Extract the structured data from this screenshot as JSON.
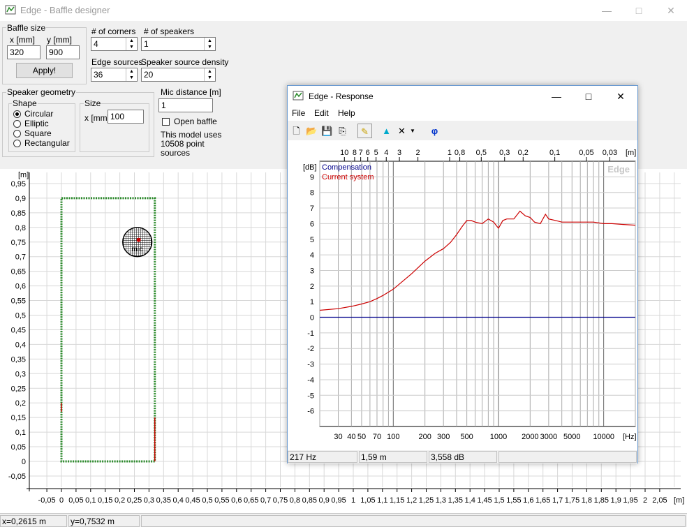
{
  "window": {
    "title": "Edge - Baffle designer"
  },
  "baffle": {
    "group_label": "Baffle size",
    "x_label": "x [mm]",
    "y_label": "y [mm]",
    "x_value": "320",
    "y_value": "900",
    "apply_label": "Apply!"
  },
  "corners": {
    "label": "# of corners",
    "value": "4"
  },
  "speakers": {
    "label": "# of speakers",
    "value": "1"
  },
  "edge_sources": {
    "label": "Edge sources",
    "value": "36"
  },
  "density": {
    "label": "Speaker source density",
    "value": "20"
  },
  "geometry": {
    "group_label": "Speaker geometry",
    "shape_label": "Shape",
    "shapes": [
      "Circular",
      "Elliptic",
      "Square",
      "Rectangular"
    ],
    "selected_shape": "Circular",
    "size_label": "Size",
    "size_x_label": "x [mm]",
    "size_x_value": "100"
  },
  "mic": {
    "label": "Mic distance [m]",
    "value": "1",
    "open_baffle_label": "Open baffle",
    "mic_marker": "mic"
  },
  "model_info": [
    "This model uses",
    "10508 point",
    "sources"
  ],
  "baffle_plot": {
    "unit_y": "[m]",
    "unit_x": "[m]",
    "y_ticks": [
      "0,95",
      "0,9",
      "0,85",
      "0,8",
      "0,75",
      "0,7",
      "0,65",
      "0,6",
      "0,55",
      "0,5",
      "0,45",
      "0,4",
      "0,35",
      "0,3",
      "0,25",
      "0,2",
      "0,15",
      "0,1",
      "0,05",
      "0",
      "-0,05"
    ],
    "x_ticks": [
      "-0,05",
      "0",
      "0,05",
      "0,1",
      "0,15",
      "0,2",
      "0,25",
      "0,3",
      "0,35",
      "0,4",
      "0,45",
      "0,5",
      "0,55",
      "0,6",
      "0,65",
      "0,7",
      "0,75",
      "0,8",
      "0,85",
      "0,9",
      "0,95",
      "1",
      "1,05",
      "1,1",
      "1,15",
      "1,2",
      "1,25",
      "1,3",
      "1,35",
      "1,4",
      "1,45",
      "1,5",
      "1,55",
      "1,6",
      "1,65",
      "1,7",
      "1,75",
      "1,8",
      "1,85",
      "1,9",
      "1,95",
      "2",
      "2,05"
    ],
    "baffle_width_m": 0.32,
    "baffle_height_m": 0.9,
    "speaker_center_m": [
      0.26,
      0.75
    ],
    "speaker_diameter_m": 0.1
  },
  "status": {
    "x": "x=0,2615 m",
    "y": "y=0,7532 m"
  },
  "response": {
    "title": "Edge - Response",
    "menus": [
      "File",
      "Edit",
      "Help"
    ],
    "watermark": "Edge",
    "legend": [
      {
        "name": "Compensation",
        "color": "#00008b"
      },
      {
        "name": "Current system",
        "color": "#cc0000"
      }
    ],
    "y_unit": "[dB]",
    "x_unit": "[Hz]",
    "top_unit": "[m]",
    "y_ticks": [
      "9",
      "8",
      "7",
      "6",
      "5",
      "4",
      "3",
      "2",
      "1",
      "0",
      "-1",
      "-2",
      "-3",
      "-4",
      "-5",
      "-6"
    ],
    "x_ticks": [
      "30",
      "40",
      "50",
      "70",
      "100",
      "200",
      "300",
      "500",
      "1000",
      "2000",
      "3000",
      "5000",
      "10000"
    ],
    "top_ticks": [
      "10",
      "8",
      "7",
      "6",
      "5",
      "4",
      "3",
      "2",
      "1",
      "0,8",
      "0,5",
      "0,3",
      "0,2",
      "0,1",
      "0,05",
      "0,03"
    ],
    "status_freq": "217 Hz",
    "status_wavelength": "1,59 m",
    "status_db": "3,558 dB"
  },
  "chart_data": {
    "type": "line",
    "xlabel": "[Hz]",
    "ylabel": "[dB]",
    "xscale": "log",
    "xlim": [
      20,
      20000
    ],
    "ylim": [
      -7,
      10
    ],
    "series": [
      {
        "name": "Compensation",
        "x": [
          20,
          20000
        ],
        "values": [
          0,
          0
        ]
      },
      {
        "name": "Current system",
        "x": [
          20,
          30,
          40,
          50,
          60,
          70,
          80,
          100,
          150,
          200,
          250,
          300,
          350,
          400,
          450,
          500,
          550,
          600,
          700,
          800,
          900,
          1000,
          1100,
          1200,
          1400,
          1600,
          1800,
          2000,
          2200,
          2500,
          2800,
          3000,
          3500,
          4000,
          5000,
          6000,
          8000,
          10000,
          12000,
          15000,
          20000
        ],
        "values": [
          0.45,
          0.55,
          0.7,
          0.85,
          1.0,
          1.2,
          1.4,
          1.8,
          2.8,
          3.6,
          4.1,
          4.4,
          4.8,
          5.3,
          5.8,
          6.2,
          6.2,
          6.1,
          6.0,
          6.3,
          6.1,
          5.7,
          6.2,
          6.3,
          6.3,
          6.8,
          6.5,
          6.4,
          6.1,
          6.0,
          6.6,
          6.3,
          6.2,
          6.1,
          6.1,
          6.1,
          6.1,
          6.0,
          6.0,
          5.95,
          5.9
        ]
      }
    ]
  }
}
